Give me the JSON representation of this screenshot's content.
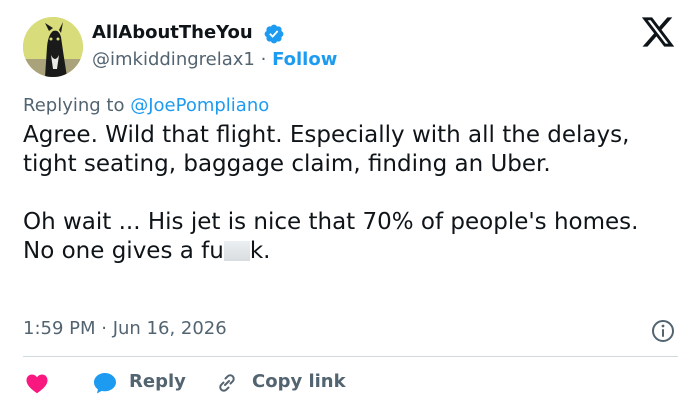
{
  "author": {
    "display_name": "AllAboutTheYou",
    "handle": "@imkiddingrelax1",
    "separator": "·",
    "follow_label": "Follow",
    "verified": true
  },
  "reply_context": {
    "prefix": "Replying to",
    "mention": "@JoePompliano"
  },
  "tweet": {
    "paragraph_1": "Agree.  Wild that flight. Especially with all the delays, tight seating, baggage claim, finding an Uber.",
    "paragraph_2_before_censor": "Oh wait ... His jet is nice that 70% of people's homes.  No one gives a fu",
    "paragraph_2_after_censor": "k."
  },
  "meta": {
    "timestamp": "1:59 PM · Jun 16, 2026"
  },
  "actions": {
    "reply_label": "Reply",
    "copy_link_label": "Copy link"
  },
  "icons": {
    "verified": "verified-badge-icon",
    "logo": "x-logo-icon",
    "info": "info-icon",
    "like": "heart-icon",
    "reply": "reply-bubble-icon",
    "link": "link-icon"
  },
  "colors": {
    "accent": "#1d9bf0",
    "text_primary": "#0f1419",
    "text_secondary": "#536471",
    "like": "#f91880",
    "divider": "#cfd9de",
    "avatar_bg": "#d8dc7a"
  }
}
